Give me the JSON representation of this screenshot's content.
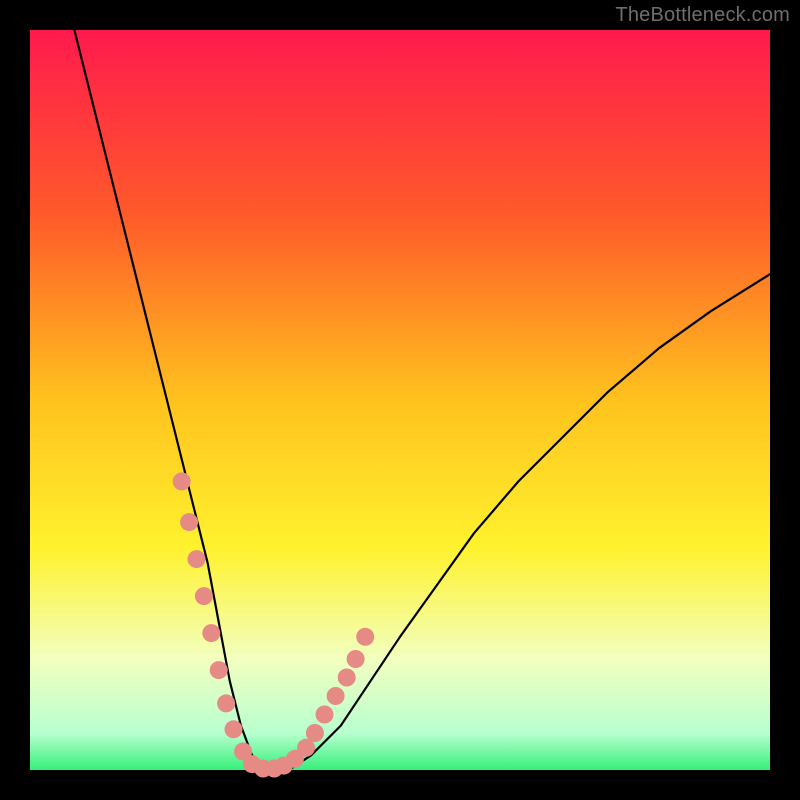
{
  "watermark": "TheBottleneck.com",
  "chart_data": {
    "type": "line",
    "title": "",
    "xlabel": "",
    "ylabel": "",
    "xlim": [
      0,
      100
    ],
    "ylim": [
      0,
      100
    ],
    "grid": false,
    "legend": false,
    "background_gradient": {
      "stops": [
        {
          "offset": 0.0,
          "color": "#ff1a4d"
        },
        {
          "offset": 0.25,
          "color": "#ff5a2a"
        },
        {
          "offset": 0.5,
          "color": "#ffc21e"
        },
        {
          "offset": 0.7,
          "color": "#fff22e"
        },
        {
          "offset": 0.85,
          "color": "#f2ffbf"
        },
        {
          "offset": 0.95,
          "color": "#b8ffcf"
        },
        {
          "offset": 1.0,
          "color": "#35f07a"
        }
      ]
    },
    "series": [
      {
        "name": "bottleneck-curve",
        "color": "#000000",
        "x": [
          6,
          8,
          10,
          12,
          14,
          16,
          18,
          20,
          22,
          24,
          25.5,
          27,
          28.5,
          30,
          32,
          35,
          38,
          42,
          46,
          50,
          55,
          60,
          66,
          72,
          78,
          85,
          92,
          100
        ],
        "y": [
          100,
          92,
          84,
          76,
          68,
          60,
          52,
          44,
          36,
          28,
          20,
          12,
          6,
          2,
          0,
          0,
          2,
          6,
          12,
          18,
          25,
          32,
          39,
          45,
          51,
          57,
          62,
          67
        ]
      }
    ],
    "overlay_points": {
      "name": "highlight-dots",
      "color": "#e58a85",
      "radius_px": 9,
      "x": [
        20.5,
        21.5,
        22.5,
        23.5,
        24.5,
        25.5,
        26.5,
        27.5,
        28.8,
        30.0,
        31.5,
        33.0,
        34.3,
        35.8,
        37.3,
        38.5,
        39.8,
        41.3,
        42.8,
        44.0,
        45.3
      ],
      "y": [
        39,
        33.5,
        28.5,
        23.5,
        18.5,
        13.5,
        9.0,
        5.5,
        2.5,
        0.8,
        0.2,
        0.2,
        0.6,
        1.5,
        3.0,
        5.0,
        7.5,
        10.0,
        12.5,
        15.0,
        18.0
      ]
    }
  }
}
